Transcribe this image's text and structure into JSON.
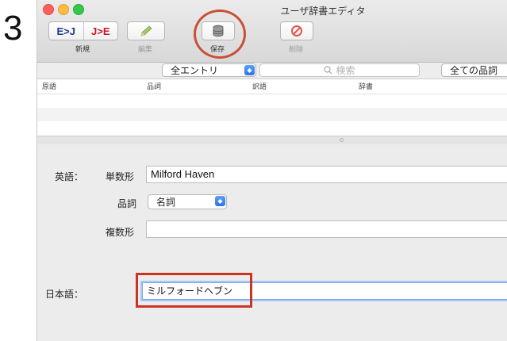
{
  "step_number": "3",
  "window": {
    "title": "ユーザ辞書エディタ"
  },
  "toolbar": {
    "ej_label": "E>J",
    "je_label": "J>E",
    "new_label": "新規",
    "edit_label": "編集",
    "save_label": "保存",
    "delete_label": "削除"
  },
  "filter": {
    "entry_filter": "全エントリ",
    "search_placeholder": "検索",
    "pos_filter": "全ての品詞"
  },
  "list": {
    "columns": [
      "原語",
      "品詞",
      "訳語",
      "辞書"
    ]
  },
  "form": {
    "english_label": "英語：",
    "singular_label": "単数形",
    "singular_value": "Milford Haven",
    "pos_label": "品詞",
    "pos_value": "名詞",
    "plural_label": "複数形",
    "plural_value": "",
    "japanese_label": "日本語：",
    "japanese_value": "ミルフォードヘブン"
  },
  "colors": {
    "annotation_red": "#cc3320",
    "accent_blue": "#2d72ea"
  }
}
